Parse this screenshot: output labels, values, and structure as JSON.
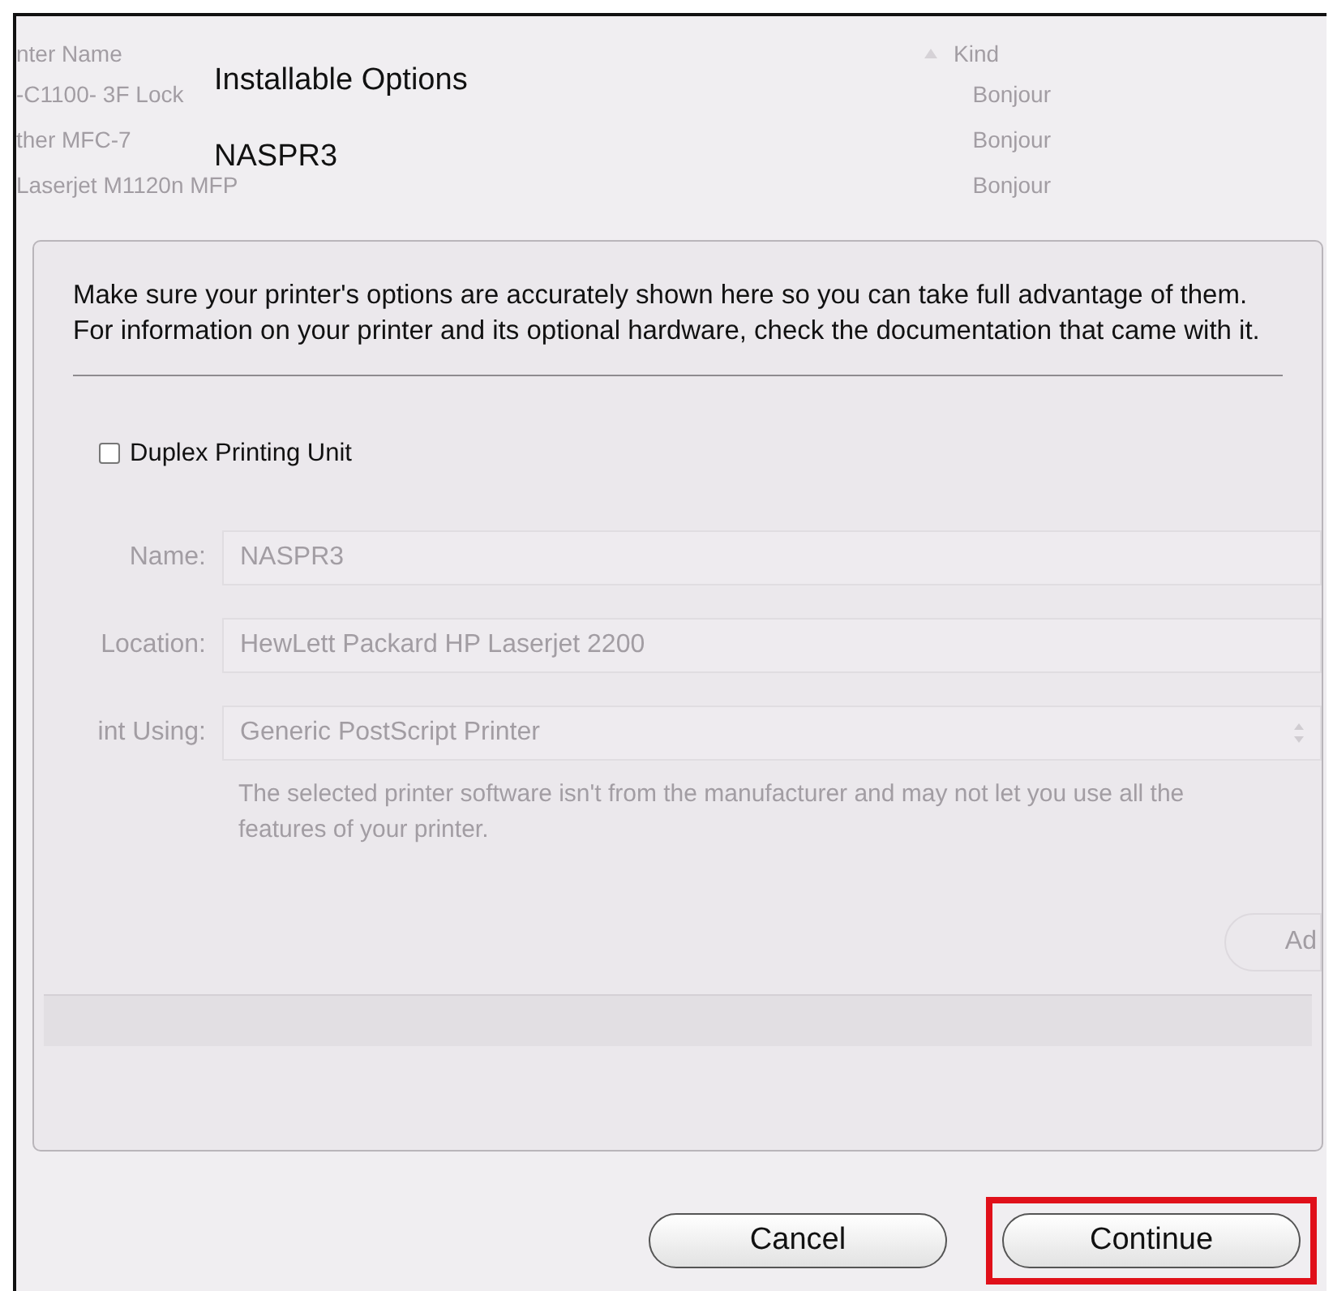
{
  "window": {
    "title": "Installable Options",
    "subtitle": "NASPR3"
  },
  "background_list": {
    "columns": [
      "nter Name",
      "Kind"
    ],
    "rows": [
      {
        "name": "-C1100- 3F Lock",
        "kind": "Bonjour"
      },
      {
        "name": "ther MFC-7",
        "kind": "Bonjour"
      },
      {
        "name": "Laserjet M1120n MFP",
        "kind": "Bonjour"
      }
    ]
  },
  "message": "Make sure your printer's options are accurately shown here so you can take full advantage of them.  For information on your printer and its optional hardware, check the documentation that came with it.",
  "options": [
    {
      "label": "Duplex Printing Unit",
      "checked": false
    }
  ],
  "background_form": {
    "fields": [
      {
        "label": "Name:",
        "value": "NASPR3",
        "kind": "text"
      },
      {
        "label": "Location:",
        "value": "HewLett Packard HP Laserjet 2200",
        "kind": "text"
      },
      {
        "label": "int Using:",
        "value": "Generic PostScript Printer",
        "kind": "select"
      }
    ],
    "note": "The selected printer software isn't from the manufacturer and may not let you use all the features of your printer.",
    "button": "Ad"
  },
  "buttons": [
    {
      "label": "Cancel",
      "highlighted": false
    },
    {
      "label": "Continue",
      "highlighted": true
    }
  ]
}
